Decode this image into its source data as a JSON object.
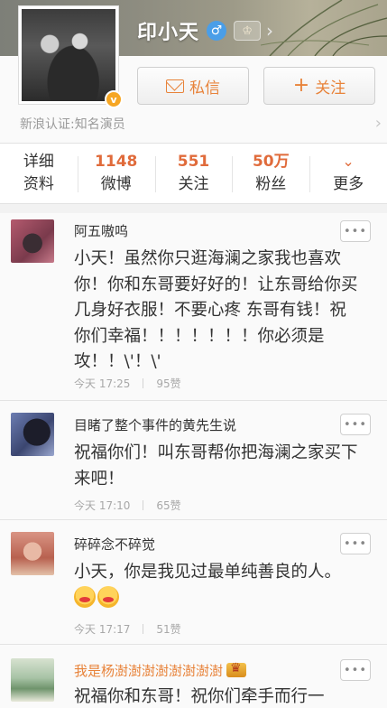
{
  "profile": {
    "name": "印小天",
    "gender_symbol": "♂",
    "vip_symbol": "v",
    "crown_symbol": "♔",
    "verification": "新浪认证:知名演员",
    "message_label": "私信",
    "follow_label": "关注",
    "follow_symbol": "+"
  },
  "stats": {
    "details_line1": "详细",
    "details_line2": "资料",
    "weibo_count": "1148",
    "weibo_label": "微博",
    "following_count": "551",
    "following_label": "关注",
    "fans_count": "50万",
    "fans_label": "粉丝",
    "more_label": "更多",
    "more_symbol": "⌄"
  },
  "more_button_label": "•••",
  "comments": [
    {
      "name": "阿五嗷呜",
      "text": "小天！虽然你只逛海澜之家我也喜欢你！你和东哥要好好的！让东哥给你买几身好衣服！不要心疼 东哥有钱！祝你们幸福！！！！！！！你必须是攻！！\\'！\\'",
      "time": "今天 17:25",
      "likes": "95赞"
    },
    {
      "name": "目睹了整个事件的黄先生说",
      "text": "祝福你们！叫东哥帮你把海澜之家买下来吧！",
      "time": "今天 17:10",
      "likes": "65赞"
    },
    {
      "name": "碎碎念不碎觉",
      "text": "小天，你是我见过最单纯善良的人。",
      "time": "今天 17:17",
      "likes": "51赞"
    },
    {
      "name": "我是杨澍澍澍澍澍澍澍澍",
      "text": "祝福你和东哥！祝你们牵手而行一",
      "time": "",
      "likes": ""
    }
  ]
}
